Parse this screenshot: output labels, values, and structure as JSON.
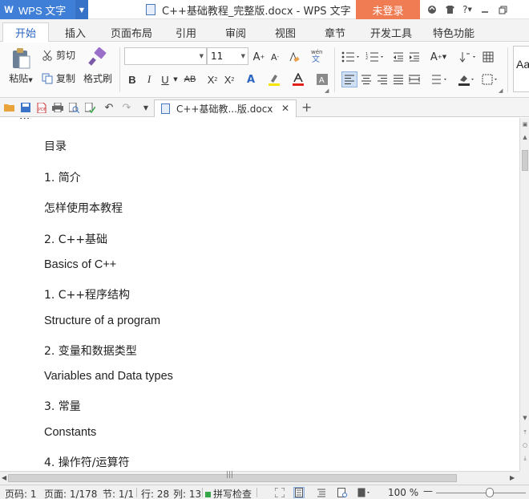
{
  "window": {
    "app_name": "WPS 文字",
    "title": "C++基础教程_完整版.docx - WPS 文字",
    "login_label": "未登录",
    "accent": "#3f7fd8",
    "login_color": "#f07c54"
  },
  "tabs": [
    {
      "label": "开始",
      "active": true
    },
    {
      "label": "插入"
    },
    {
      "label": "页面布局"
    },
    {
      "label": "引用"
    },
    {
      "label": "审阅"
    },
    {
      "label": "视图"
    },
    {
      "label": "章节"
    },
    {
      "label": "开发工具"
    },
    {
      "label": "特色功能"
    }
  ],
  "ribbon": {
    "paste": "粘贴",
    "cut": "剪切",
    "copy": "复制",
    "format_painter": "格式刷",
    "font_name": "",
    "font_size": "11",
    "bold": "B",
    "italic": "I",
    "underline": "U",
    "strike": "AB",
    "style_preview": "Aa"
  },
  "doc_tab": {
    "label": "C++基础教...版.docx"
  },
  "document": {
    "cut_line": "...",
    "paragraphs": [
      {
        "text": "目录",
        "lang": "zh"
      },
      {
        "text": "1. 简介",
        "lang": "zh"
      },
      {
        "text": "怎样使用本教程",
        "lang": "zh"
      },
      {
        "text": "2. C++基础",
        "lang": "zh"
      },
      {
        "text": "Basics of C++",
        "lang": "en"
      },
      {
        "text": "1. C++程序结构",
        "lang": "zh"
      },
      {
        "text": "Structure of a program",
        "lang": "en"
      },
      {
        "text": "2. 变量和数据类型",
        "lang": "zh"
      },
      {
        "text": "Variables and Data types",
        "lang": "en"
      },
      {
        "text": "3. 常量",
        "lang": "zh"
      },
      {
        "text": "Constants",
        "lang": "en"
      },
      {
        "text": "4. 操作符/运算符",
        "lang": "zh"
      }
    ]
  },
  "status": {
    "page_no": "页码: 1",
    "pages": "页面: 1/178",
    "section": "节: 1/1",
    "row": "行: 28",
    "col": "列: 13",
    "spell": "拼写检查",
    "zoom": "100 %",
    "spell_color": "#37a64a"
  }
}
